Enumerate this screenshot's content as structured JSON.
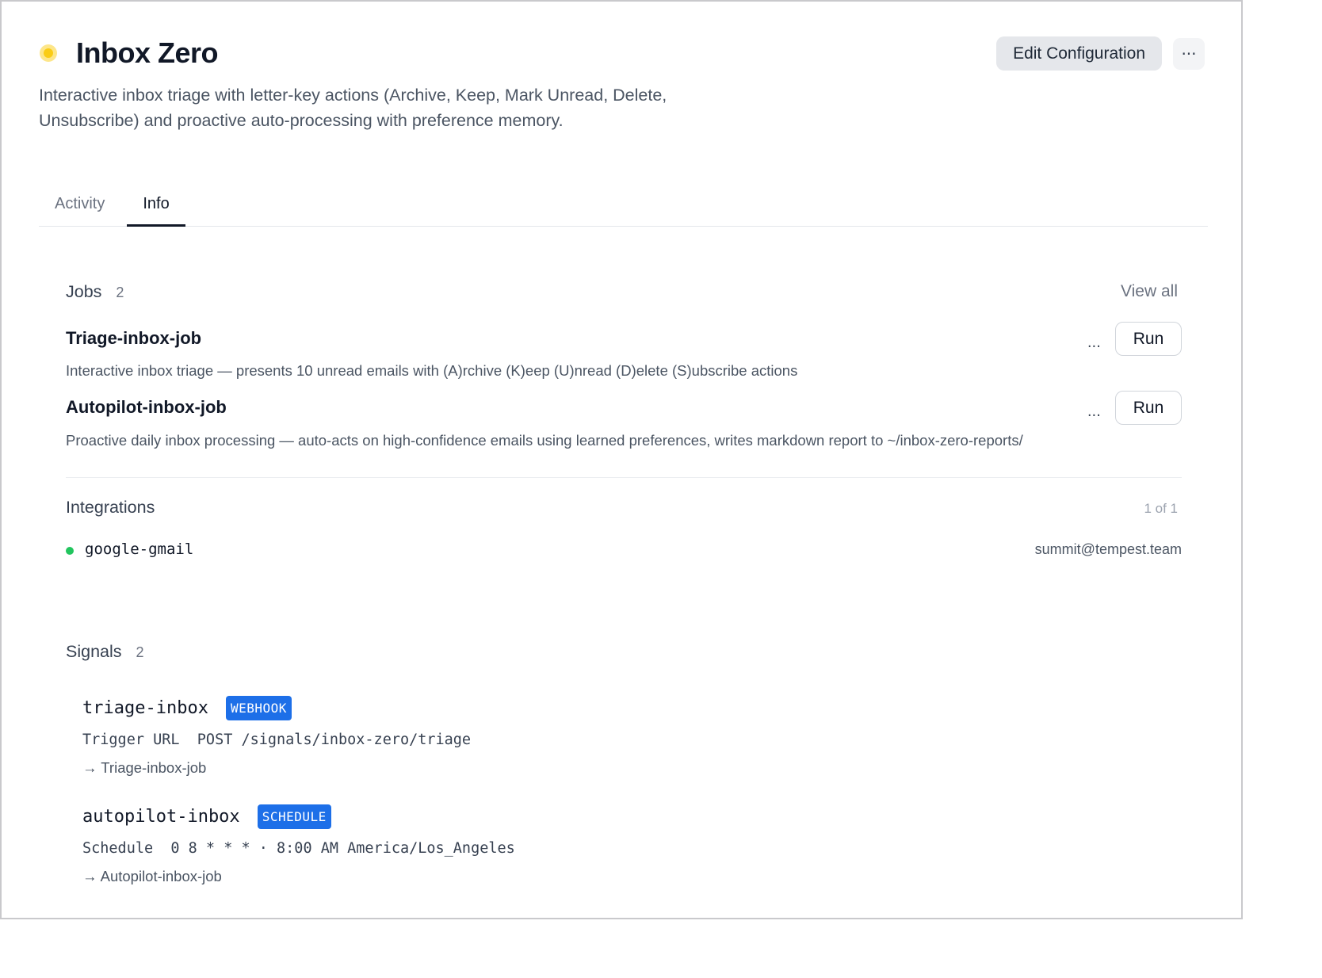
{
  "header": {
    "title": "Inbox Zero",
    "status_color": "#facc15",
    "edit_label": "Edit Configuration",
    "more_label": "···",
    "description": "Interactive inbox triage with letter-key actions (Archive, Keep, Mark Unread, Delete, Unsubscribe) and proactive auto-processing with preference memory."
  },
  "tabs": [
    {
      "label": "Activity",
      "active": false
    },
    {
      "label": "Info",
      "active": true
    }
  ],
  "jobs": {
    "title": "Jobs",
    "count": "2",
    "view_all": "View all",
    "items": [
      {
        "name": "Triage-inbox-job",
        "description": "Interactive inbox triage — presents 10 unread emails with (A)rchive (K)eep (U)nread (D)elete (S)ubscribe actions",
        "more": "...",
        "run_label": "Run"
      },
      {
        "name": "Autopilot-inbox-job",
        "description": "Proactive daily inbox processing — auto-acts on high-confidence emails using learned preferences, writes markdown report to ~/inbox-zero-reports/",
        "more": "...",
        "run_label": "Run"
      }
    ]
  },
  "integrations": {
    "title": "Integrations",
    "pager": "1 of 1",
    "items": [
      {
        "name": "google-gmail",
        "account": "summit@tempest.team",
        "status_color": "#22c55e"
      }
    ]
  },
  "signals": {
    "title": "Signals",
    "count": "2",
    "items": [
      {
        "name": "triage-inbox",
        "badge": "WEBHOOK",
        "detail": "Trigger URL  POST /signals/inbox-zero/triage",
        "target": "→ Triage-inbox-job"
      },
      {
        "name": "autopilot-inbox",
        "badge": "SCHEDULE",
        "detail": "Schedule  0 8 * * * · 8:00 AM America/Los_Angeles",
        "target": "→ Autopilot-inbox-job"
      }
    ]
  },
  "colors": {
    "accent_badge": "#1d6fe8",
    "text_primary": "#111827",
    "text_secondary": "#4b5563"
  }
}
